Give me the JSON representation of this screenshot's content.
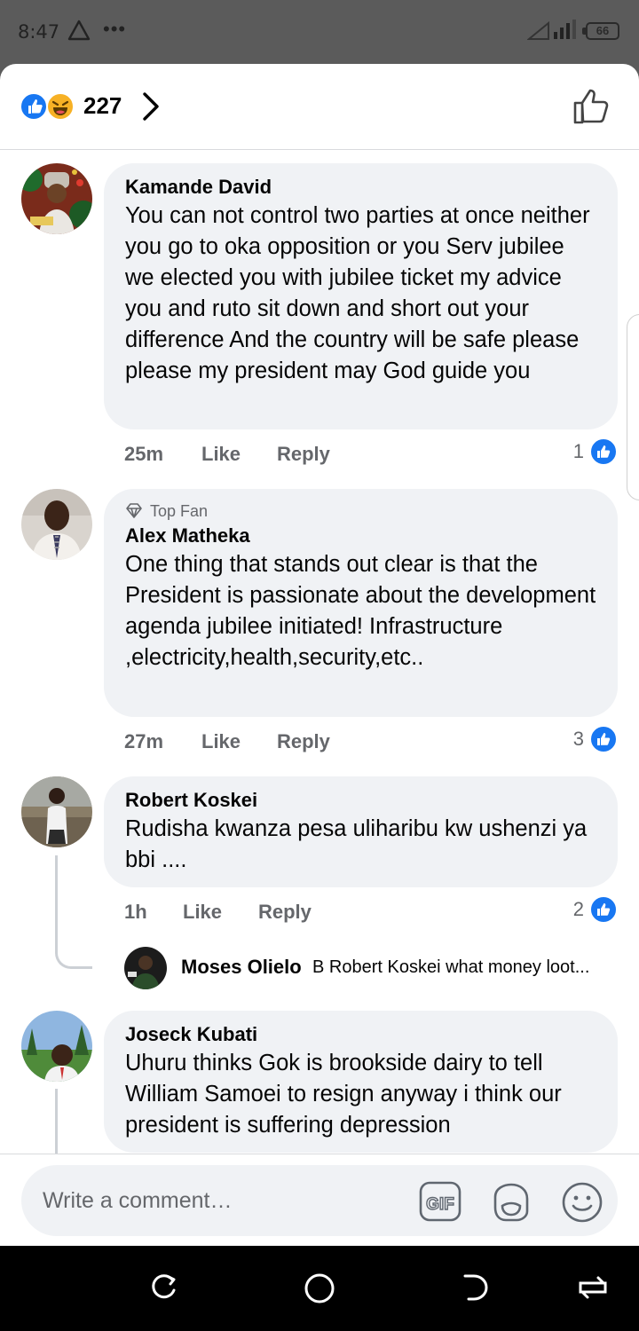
{
  "status_bar": {
    "time": "8:47",
    "dots": "•••",
    "battery": "66"
  },
  "reactions_bar": {
    "count": "227"
  },
  "comments": [
    {
      "author": "Kamande David",
      "text": "You can not  control two parties at once neither  you go to oka opposition or you Serv jubilee we elected you with jubilee ticket  my advice you and ruto sit down and short out your difference And the country will be safe please please my president may God guide you",
      "time": "25m",
      "like": "Like",
      "reply": "Reply",
      "reactions": "1"
    },
    {
      "badge": "Top Fan",
      "author": "Alex Matheka",
      "text": "One thing that stands out clear is that the President is passionate about the development agenda jubilee initiated! Infrastructure ,electricity,health,security,etc..",
      "time": "27m",
      "like": "Like",
      "reply": "Reply",
      "reactions": "3"
    },
    {
      "author": "Robert Koskei",
      "text": "Rudisha kwanza pesa uliharibu kw ushenzi ya bbi ....",
      "time": "1h",
      "like": "Like",
      "reply": "Reply",
      "reactions": "2",
      "reply_preview": {
        "author": "Moses Olielo",
        "text": "B Robert Koskei what money loot..."
      }
    },
    {
      "author": "Joseck Kubati",
      "text": "Uhuru thinks Gok is brookside dairy to tell William Samoei to resign anyway i think our president is suffering depression"
    }
  ],
  "composer": {
    "placeholder": "Write a comment…",
    "gif_label": "GIF"
  },
  "colors": {
    "accent": "#1877f2",
    "bubble": "#f0f2f5",
    "meta": "#65676b"
  }
}
